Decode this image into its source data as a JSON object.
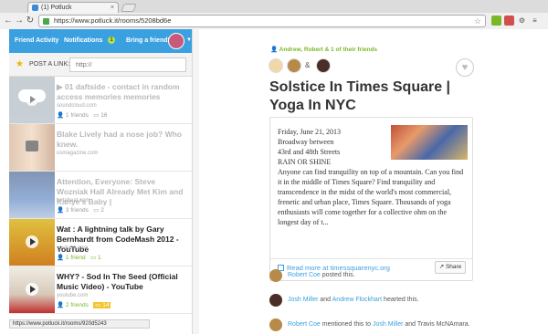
{
  "browser": {
    "tab_title": "(1) Potluck",
    "url": "https://www.potluck.it/rooms/5208bd6e",
    "status_url": "https://www.potluck.it/rooms/920d5243"
  },
  "nav": {
    "friend_activity": "Friend Activity",
    "notifications": "Notifications",
    "notifications_count": "1",
    "bring_friend": "Bring a friend!"
  },
  "post_link": {
    "label": "POST A LINK:",
    "placeholder": "http://"
  },
  "feed": [
    {
      "title": "01 daftside - contact in random access memories memories",
      "source": "soundcloud.com",
      "friends": "1 friends",
      "comments": "16",
      "style": "faded"
    },
    {
      "title": "Blake Lively had a nose job? Who knew.",
      "source": "usmagazine.com",
      "friends": "",
      "comments": "",
      "style": "faded"
    },
    {
      "title": "Attention, Everyone: Steve Wozniak Hall Already Met Kim and Kanye's Baby |",
      "source": "betabeat.com",
      "friends": "3 friends",
      "comments": "2",
      "style": "faded"
    },
    {
      "title": "Wat : A lightning talk by Gary Bernhardt from CodeMash 2012 - YouTube",
      "source": "youtube.com",
      "friends": "1 friend",
      "comments": "1",
      "style": "dark"
    },
    {
      "title": "WHY? - Sod In The Seed (Official Music Video) - YouTube",
      "source": "youtube.com",
      "friends": "2 friends",
      "comments": "14",
      "style": "dark"
    }
  ],
  "post": {
    "friends_line": "Andrew, Robert & 1 of their friends",
    "amp": "&",
    "title": "Solstice In Times Square | Yoga In NYC",
    "body": "Friday, June 21, 2013 Broadway between 43rd and 48th Streets RAIN OR SHINE Anyone can find tranquility on top of a mountain. Can you find it in the middle of Times Square? Find tranquility and transcendence in the midst of the world's most commercial, frenetic and urban place, Times Square. Thousands of yoga enthusiasts will come together for a collective ohm on the longest day of t...",
    "read_more": "Read more at timessquarenyc.org",
    "share": "Share"
  },
  "activity": [
    {
      "name1": "Robert Coe",
      "text": " posted this.",
      "name2": "",
      "text2": ""
    },
    {
      "name1": "Josh Miller",
      "text": " and ",
      "name2": "Andrew Flockhart",
      "text2": " hearted this."
    },
    {
      "name1": "Robert Coe",
      "text": " mentioned this to ",
      "name2": "Josh Miller",
      "text2": " and Travis McNAmara."
    }
  ],
  "colors": {
    "accent": "#3ba0e0",
    "green": "#7ab828"
  }
}
